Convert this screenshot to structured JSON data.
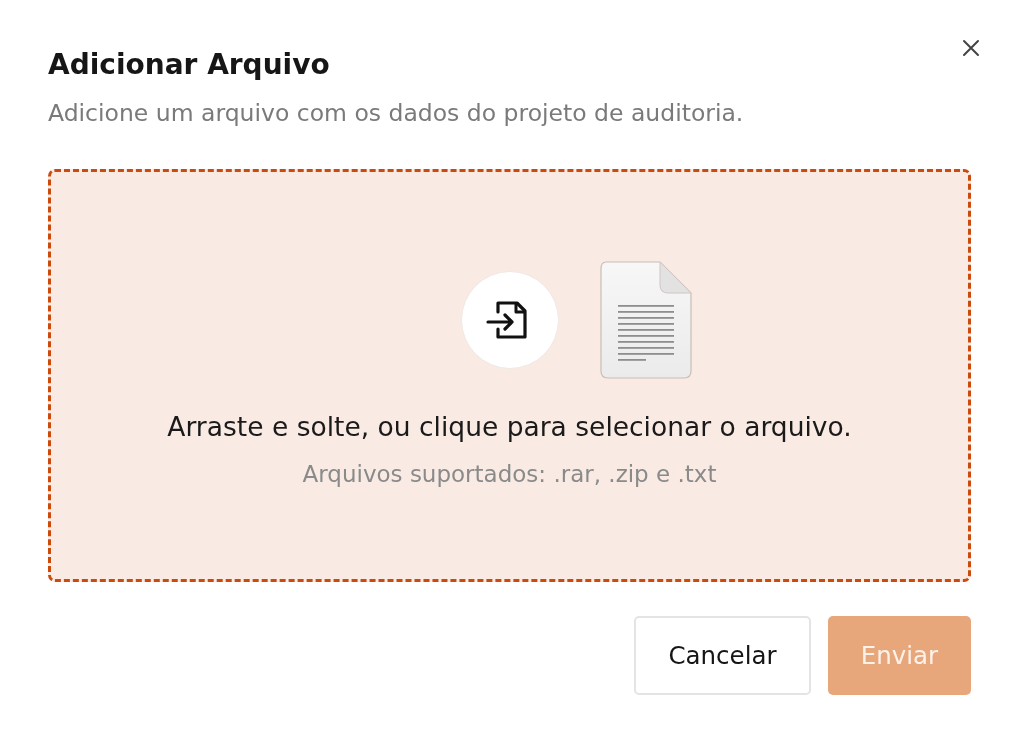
{
  "dialog": {
    "title": "Adicionar Arquivo",
    "subtitle": "Adicione um arquivo com os dados do projeto de auditoria."
  },
  "dropzone": {
    "instruction": "Arraste e solte, ou clique para selecionar o arquivo.",
    "supported_formats": "Arquivos suportados: .rar, .zip e .txt"
  },
  "buttons": [
    {
      "label": "Cancelar",
      "kind": "secondary",
      "disabled": false
    },
    {
      "label": "Enviar",
      "kind": "primary",
      "disabled": true
    }
  ]
}
